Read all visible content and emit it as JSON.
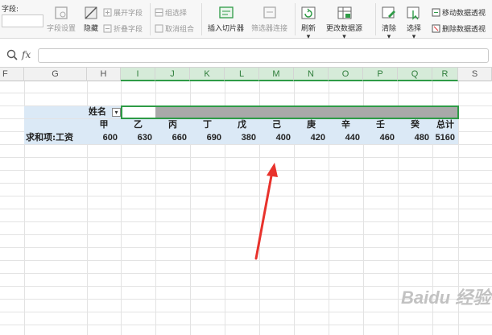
{
  "ribbon": {
    "field_label": "字段:",
    "field_settings": "字段设置",
    "hide": "隐藏",
    "expand_field": "展开字段",
    "collapse_field": "折叠字段",
    "group_selection": "组选择",
    "ungroup": "取消组合",
    "insert_slicer": "插入切片器",
    "filter_connection": "筛选器连接",
    "refresh": "刷新",
    "change_datasource": "更改数据源",
    "clear": "清除",
    "select": "选择",
    "move_pivot": "移动数据透视",
    "delete_pivot": "删除数据透视"
  },
  "formula_bar": {
    "fx": "fx",
    "value": ""
  },
  "columns": [
    "F",
    "G",
    "H",
    "I",
    "J",
    "K",
    "L",
    "M",
    "N",
    "O",
    "P",
    "Q",
    "R",
    "S"
  ],
  "pivot": {
    "filter_label": "姓名",
    "row_label": "求和项:工资",
    "headers": [
      "甲",
      "乙",
      "丙",
      "丁",
      "戊",
      "己",
      "庚",
      "辛",
      "壬",
      "癸",
      "总计"
    ],
    "values": [
      "600",
      "630",
      "660",
      "690",
      "380",
      "400",
      "420",
      "440",
      "460",
      "480",
      "5160"
    ]
  },
  "watermark": "Baidu 经验",
  "colors": {
    "accent": "#2e9b46",
    "pivot_fill": "#dbe9f6",
    "arrow": "#e8322c"
  }
}
